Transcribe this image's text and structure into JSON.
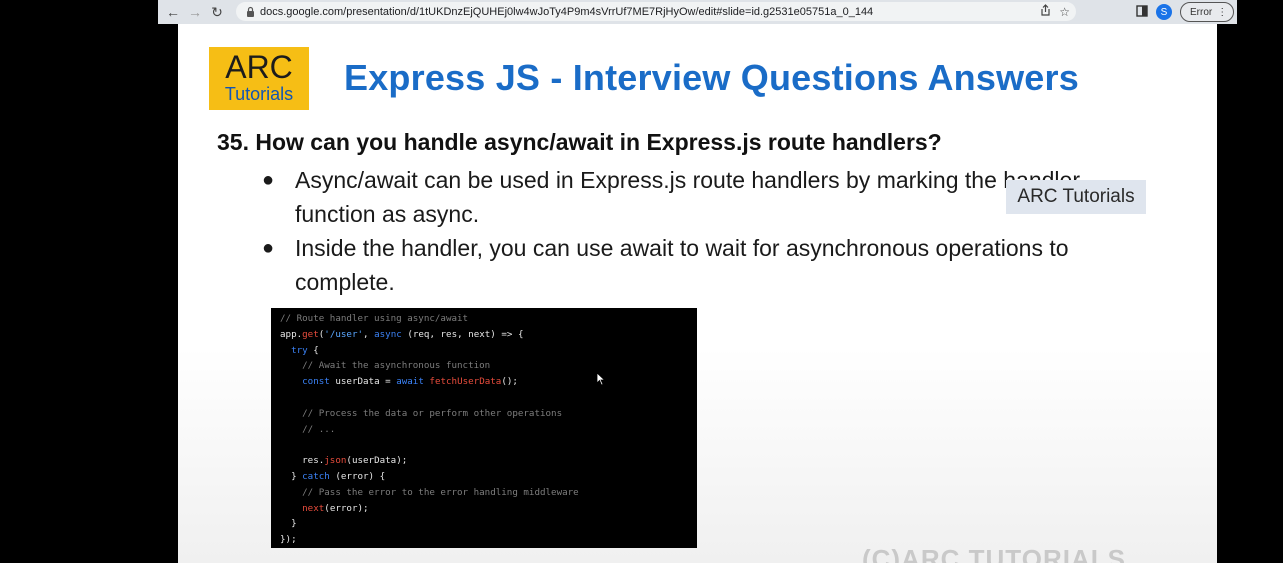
{
  "browser": {
    "url": "docs.google.com/presentation/d/1tUKDnzEjQUHEj0lw4wJoTy4P9m4sVrrUf7ME7RjHyOw/edit#slide=id.g2531e05751a_0_144",
    "avatar_letter": "S",
    "error_label": "Error"
  },
  "slide": {
    "logo_main": "ARC",
    "logo_sub": "Tutorials",
    "title": "Express JS - Interview Questions Answers",
    "question": "35. How can you handle async/await in Express.js route handlers?",
    "bullets": [
      "Async/await can be used in Express.js route handlers by marking the handler function as async.",
      "Inside the handler, you can use await to wait for asynchronous operations to complete."
    ],
    "watermark": "ARC Tutorials",
    "copyright": "(C)ARC TUTORIALS"
  },
  "code_lines": [
    "// Route handler using async/await",
    "app.get('/user', async (req, res, next) => {",
    "  try {",
    "    // Await the asynchronous function",
    "    const userData = await fetchUserData();",
    "",
    "    // Process the data or perform other operations",
    "    // ...",
    "",
    "    res.json(userData);",
    "  } catch (error) {",
    "    // Pass the error to the error handling middleware",
    "    next(error);",
    "  }",
    "});"
  ],
  "colors": {
    "title": "#1a6cc7",
    "logo_bg": "#f6be15",
    "logo_sub": "#1155b5",
    "code_bg": "#000000"
  }
}
